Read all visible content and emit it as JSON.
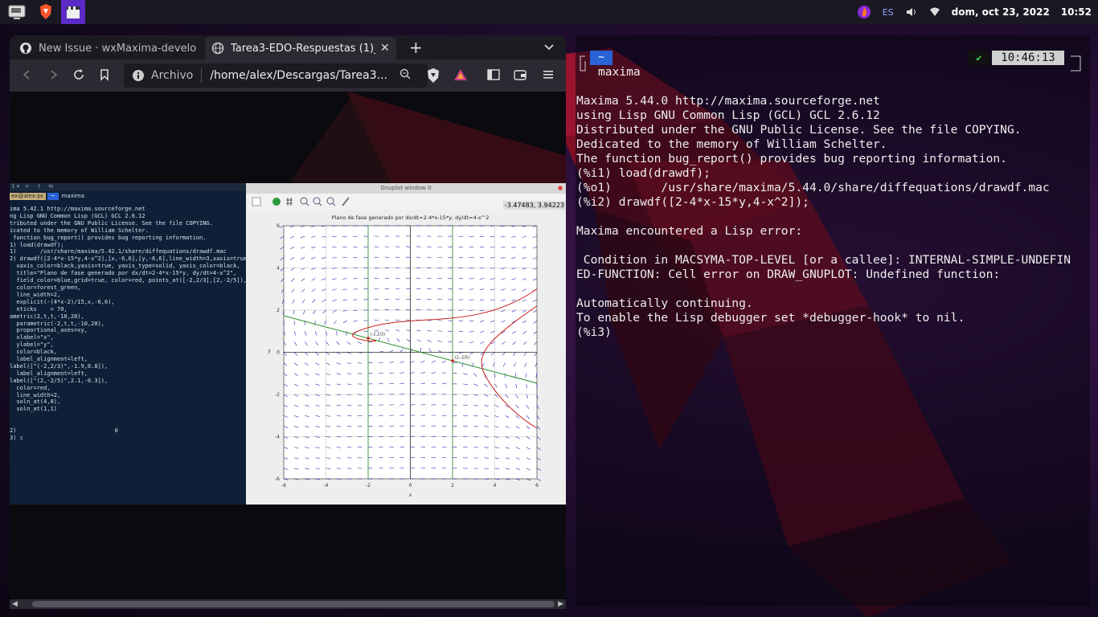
{
  "top_panel": {
    "launchers": [
      "monitor-launcher",
      "brave-launcher",
      "clapper-launcher"
    ],
    "keyboard_layout": "ES",
    "datetime": "dom, oct 23, 2022",
    "clock": "10:52"
  },
  "browser": {
    "tabs": [
      {
        "title": "New Issue · wxMaxima-develo",
        "icon": "github-icon"
      },
      {
        "title": "Tarea3-EDO-Respuestas (1)_",
        "icon": "globe-icon"
      }
    ],
    "url_prefix": "Archivo",
    "url": "/home/alex/Descargas/Tarea3...",
    "embedded": {
      "mini_terminal": {
        "prompt_user": "ex@alex-pc",
        "prompt_cmd": "maxima",
        "lines": [
          "ima 5.42.1 http://maxima.sourceforge.net",
          "ng Lisp GNU Common Lisp (GCL) GCL 2.6.12",
          "tributed under the GNU Public License. See the file COPYING.",
          "icated to the memory of William Schelter.",
          " function bug_report() provides bug reporting information.",
          "1) load(drawdf);",
          "1)       /usr/share/maxima/5.42.1/share/diffequations/drawdf.mac",
          "2) drawdf([2-4*x-15*y,4-x^2],[x,-6,6],[y,-6,6],line_width=3,xaxis=true,",
          "  xaxis_color=black,yaxis=true, yaxis_type=solid, yaxis_color=black,",
          "  title=\"Plano de fase generado por dx/dt=2-4*x-15*y, dy/dt=4-x^2\",",
          "  field_color=blue,grid=true, color=red, points_at([-2,2/3],[2,-2/5]),",
          "  color=forest_green,",
          "  line_width=2,",
          "  explicit(-(4*x-2)/15,x,-6,6),",
          "  nticks    = 70,",
          "ametric(2,t,t,-10,20),",
          "  parametric(-2,t,t,-10,20),",
          "  proportional_axes=xy,",
          "  xlabel=\"x\",",
          "  ylabel=\"y\",",
          "  color=black,",
          "  label_alignment=left,",
          "label([\"(-2,2/3)\",-1.9,0.8]),",
          "  label_alignment=left,",
          "label([\"(2,-2/5)\",2.1,-0.3]),",
          "  color=red,",
          "  line_width=2,",
          "  soln_at(4,8),",
          "  soln_at(1,1)",
          "",
          "",
          "2)                             0",
          "3) ▯"
        ]
      },
      "gnuplot": {
        "window_title": "Gnuplot window 0",
        "plot_title": "Plano de fase generado por dx/dt=2-4*x-15*y, dy/dt=4-x^2",
        "coords": "-3.47483, 3.94223",
        "xlabel": "x",
        "ylabel": "y",
        "point_labels": [
          "(-2,2/3)",
          "(2,-2/5)"
        ]
      }
    }
  },
  "terminal": {
    "tab_label": "~",
    "title": "maxima",
    "status_check": "✔",
    "time": "10:46:13",
    "output": [
      "Maxima 5.44.0 http://maxima.sourceforge.net",
      "using Lisp GNU Common Lisp (GCL) GCL 2.6.12",
      "Distributed under the GNU Public License. See the file COPYING.",
      "Dedicated to the memory of William Schelter.",
      "The function bug_report() provides bug reporting information.",
      "(%i1) load(drawdf);",
      "(%o1)       /usr/share/maxima/5.44.0/share/diffequations/drawdf.mac",
      "(%i2) drawdf([2-4*x-15*y,4-x^2]);",
      "",
      "Maxima encountered a Lisp error:",
      "",
      " Condition in MACSYMA-TOP-LEVEL [or a callee]: INTERNAL-SIMPLE-UNDEFIN",
      "ED-FUNCTION: Cell error on DRAW_GNUPLOT: Undefined function:",
      "",
      "Automatically continuing.",
      "To enable the Lisp debugger set *debugger-hook* to nil.",
      "(%i3)"
    ]
  },
  "colors": {
    "panel": "#1a1823",
    "browser_chrome": "#2b2a33",
    "active_launcher": "#5b2bc7",
    "terminal_badge": "#2a62d8",
    "wallpaper_red": "#c0142c"
  }
}
